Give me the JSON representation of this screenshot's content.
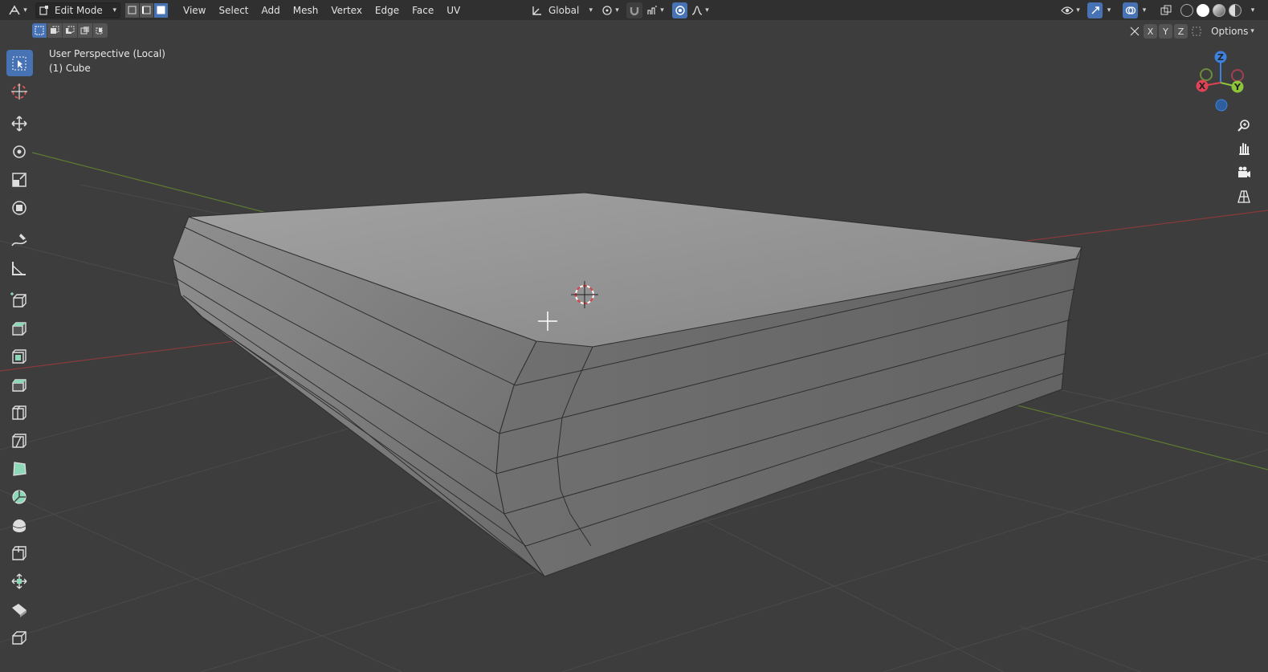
{
  "header": {
    "mode": "Edit Mode",
    "menus": [
      "View",
      "Select",
      "Add",
      "Mesh",
      "Vertex",
      "Edge",
      "Face",
      "UV"
    ],
    "orientation": "Global",
    "options_label": "Options",
    "axes": [
      "X",
      "Y",
      "Z"
    ]
  },
  "viewport": {
    "view_name": "User Perspective (Local)",
    "object_name": "(1) Cube"
  },
  "gizmo": {
    "z": "Z",
    "y": "Y",
    "x": "X"
  },
  "colors": {
    "accent": "#4772b3",
    "axis_x": "#e04355",
    "axis_y": "#8cc43a",
    "axis_z": "#3d82e0",
    "grid_x_line": "#8a3a3a",
    "grid_y_line": "#5e7a30"
  }
}
